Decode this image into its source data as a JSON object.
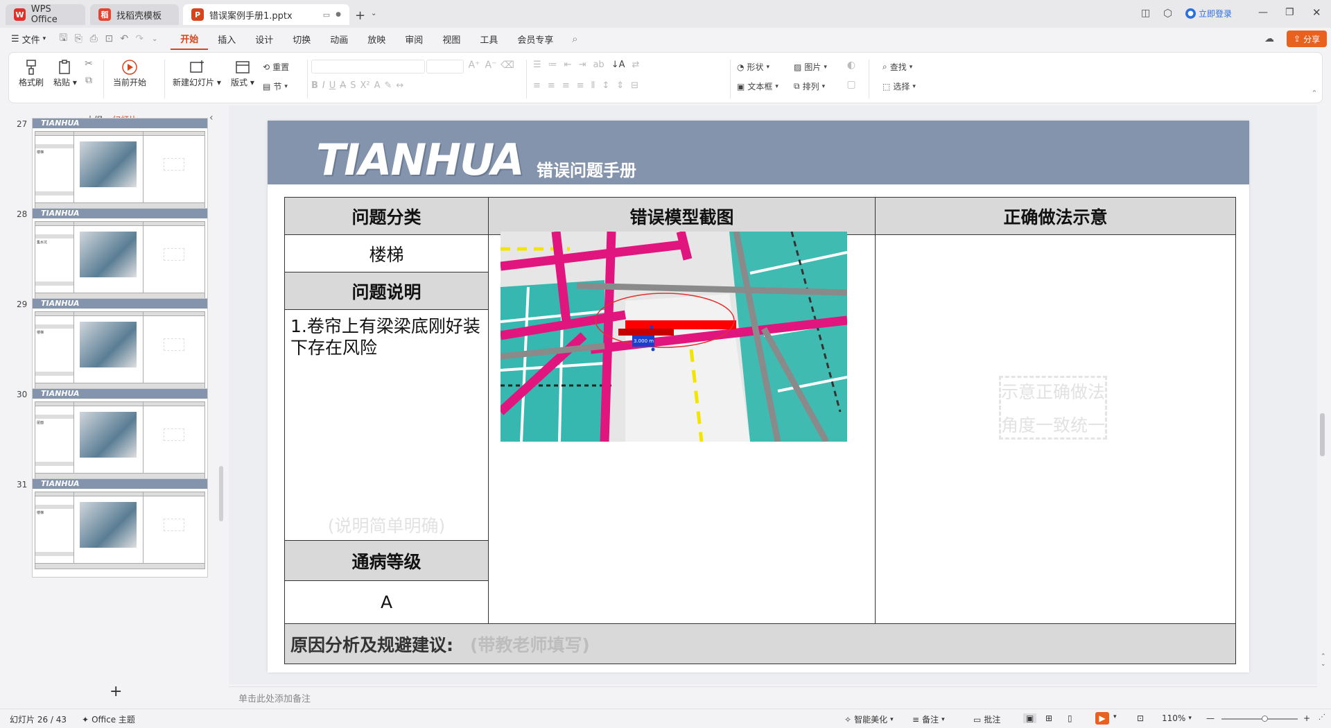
{
  "titlebar": {
    "tabs": [
      {
        "label": "WPS Office",
        "icon": "wps-logo"
      },
      {
        "label": "找稻壳模板",
        "icon": "docer-logo"
      },
      {
        "label": "错误案例手册1.pptx",
        "icon": "ppt-logo"
      }
    ],
    "login": "立即登录"
  },
  "menubar": {
    "file": "文件",
    "tabs": [
      "开始",
      "插入",
      "设计",
      "切换",
      "动画",
      "放映",
      "审阅",
      "视图",
      "工具",
      "会员专享"
    ],
    "active_tab": "开始",
    "share": "分享"
  },
  "ribbon": {
    "format_painter": "格式刷",
    "paste": "粘贴",
    "play_from_current": "当前开始",
    "new_slide": "新建幻灯片",
    "layout": "版式",
    "reset": "重置",
    "section": "节",
    "shape": "形状",
    "picture": "图片",
    "textbox": "文本框",
    "arrange": "排列",
    "find": "查找",
    "select": "选择"
  },
  "leftpanel": {
    "tab_outline": "大纲",
    "tab_slides": "幻灯片",
    "thumbnails": [
      {
        "num": "27",
        "note": "楼梯"
      },
      {
        "num": "28",
        "note": "集水坑"
      },
      {
        "num": "29",
        "note": "楼梯"
      },
      {
        "num": "30",
        "note": "屋面"
      },
      {
        "num": "31",
        "note": "楼梯"
      }
    ],
    "brand": "TIANHUA",
    "add": "+"
  },
  "slide": {
    "brand": "TIANHUA",
    "subtitle": "错误问题手册",
    "col1_header": "问题分类",
    "col2_header": "错误模型截图",
    "col3_header": "正确做法示意",
    "category_value": "楼梯",
    "desc_header": "问题说明",
    "desc_text": "1.卷帘上有梁梁底刚好装下存在风险",
    "desc_hint": "(说明简单明确)",
    "level_header": "通病等级",
    "level_value": "A",
    "correct_hint_1": "示意正确做法",
    "correct_hint_2": "角度一致统一",
    "footer_label": "原因分析及规避建议:",
    "footer_hint": "(带教老师填写)",
    "dimension_label": "3.000 m"
  },
  "notes": {
    "placeholder": "单击此处添加备注"
  },
  "statusbar": {
    "slide_counter": "幻灯片 26 / 43",
    "theme": "Office 主题",
    "beautify": "智能美化",
    "notes": "备注",
    "comments": "批注",
    "zoom": "110%"
  },
  "colors": {
    "accent": "#d6461c",
    "header": "#8494ac"
  }
}
